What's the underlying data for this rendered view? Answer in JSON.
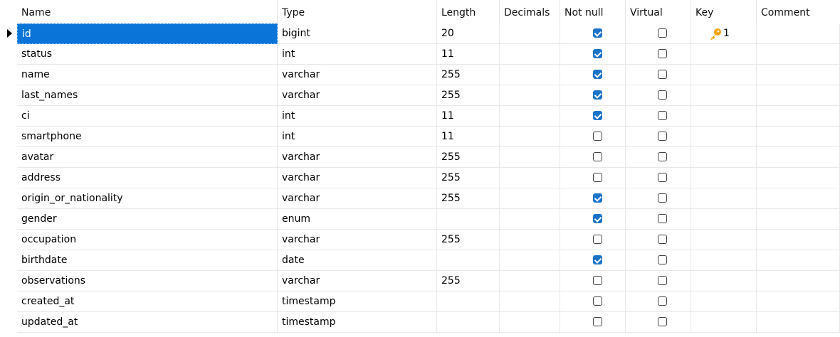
{
  "columns": [
    "Name",
    "Type",
    "Length",
    "Decimals",
    "Not null",
    "Virtual",
    "Key",
    "Comment"
  ],
  "rows": [
    {
      "name": "id",
      "type": "bigint",
      "length": "20",
      "decimals": "",
      "not_null": true,
      "virtual": false,
      "key": "1",
      "comment": "",
      "selected": true,
      "current": true
    },
    {
      "name": "status",
      "type": "int",
      "length": "11",
      "decimals": "",
      "not_null": true,
      "virtual": false,
      "key": "",
      "comment": ""
    },
    {
      "name": "name",
      "type": "varchar",
      "length": "255",
      "decimals": "",
      "not_null": true,
      "virtual": false,
      "key": "",
      "comment": ""
    },
    {
      "name": "last_names",
      "type": "varchar",
      "length": "255",
      "decimals": "",
      "not_null": true,
      "virtual": false,
      "key": "",
      "comment": ""
    },
    {
      "name": "ci",
      "type": "int",
      "length": "11",
      "decimals": "",
      "not_null": true,
      "virtual": false,
      "key": "",
      "comment": ""
    },
    {
      "name": "smartphone",
      "type": "int",
      "length": "11",
      "decimals": "",
      "not_null": false,
      "virtual": false,
      "key": "",
      "comment": ""
    },
    {
      "name": "avatar",
      "type": "varchar",
      "length": "255",
      "decimals": "",
      "not_null": false,
      "virtual": false,
      "key": "",
      "comment": ""
    },
    {
      "name": "address",
      "type": "varchar",
      "length": "255",
      "decimals": "",
      "not_null": false,
      "virtual": false,
      "key": "",
      "comment": ""
    },
    {
      "name": "origin_or_nationality",
      "type": "varchar",
      "length": "255",
      "decimals": "",
      "not_null": true,
      "virtual": false,
      "key": "",
      "comment": ""
    },
    {
      "name": "gender",
      "type": "enum",
      "length": "",
      "decimals": "",
      "not_null": true,
      "virtual": false,
      "key": "",
      "comment": ""
    },
    {
      "name": "occupation",
      "type": "varchar",
      "length": "255",
      "decimals": "",
      "not_null": false,
      "virtual": false,
      "key": "",
      "comment": ""
    },
    {
      "name": "birthdate",
      "type": "date",
      "length": "",
      "decimals": "",
      "not_null": true,
      "virtual": false,
      "key": "",
      "comment": ""
    },
    {
      "name": "observations",
      "type": "varchar",
      "length": "255",
      "decimals": "",
      "not_null": false,
      "virtual": false,
      "key": "",
      "comment": ""
    },
    {
      "name": "created_at",
      "type": "timestamp",
      "length": "",
      "decimals": "",
      "not_null": false,
      "virtual": false,
      "key": "",
      "comment": ""
    },
    {
      "name": "updated_at",
      "type": "timestamp",
      "length": "",
      "decimals": "",
      "not_null": false,
      "virtual": false,
      "key": "",
      "comment": ""
    }
  ],
  "colors": {
    "selection": "#0a74d9",
    "checkbox_on": "#1a73c9",
    "key_icon": "#f2a50c"
  },
  "icons": {
    "row_indicator": "triangle-right-icon",
    "primary_key": "key-icon"
  }
}
